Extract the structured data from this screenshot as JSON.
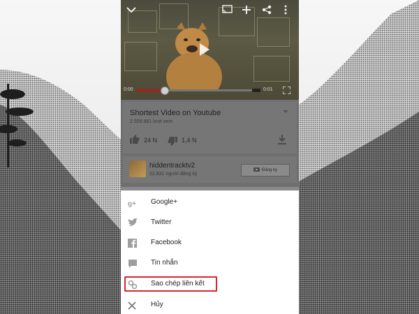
{
  "player": {
    "time_elapsed": "0:00",
    "time_total": "0:01",
    "progress": 0.23
  },
  "video": {
    "title": "Shortest Video on Youtube",
    "views": "2.559.881 lượt xem",
    "likes": "24 N",
    "dislikes": "1,4 N"
  },
  "channel": {
    "name": "hiddentracktv2",
    "subscribers": "22.831 người đăng ký",
    "subscribe_label": "Đăng ký"
  },
  "share_menu": {
    "items": [
      {
        "label": "Google+",
        "icon": "google-plus-icon"
      },
      {
        "label": "Twitter",
        "icon": "twitter-icon"
      },
      {
        "label": "Facebook",
        "icon": "facebook-icon"
      },
      {
        "label": "Tin nhắn",
        "icon": "message-icon"
      },
      {
        "label": "Sao chép liên kết",
        "icon": "link-icon"
      },
      {
        "label": "Hủy",
        "icon": "close-icon"
      }
    ]
  },
  "colors": {
    "accent_red": "#d8262f",
    "seek_red": "#b11b1b"
  }
}
